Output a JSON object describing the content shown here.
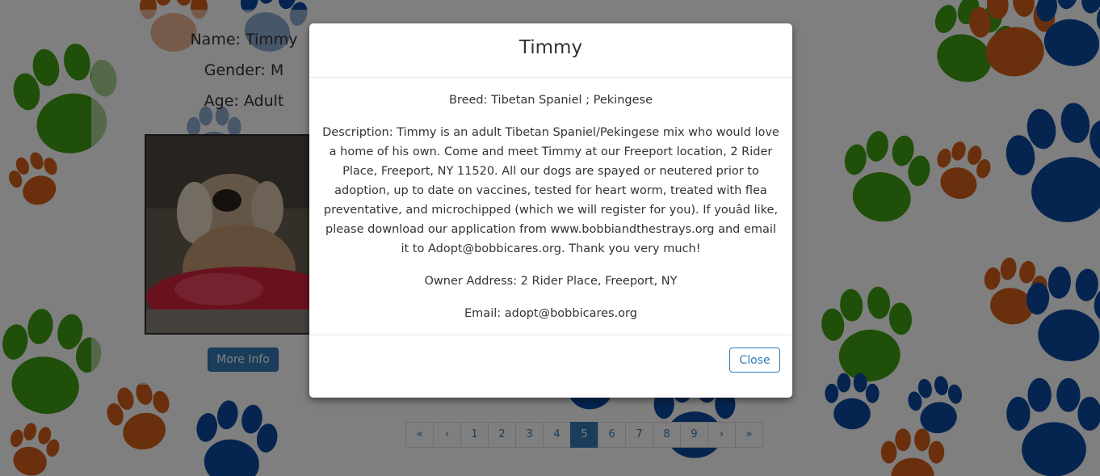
{
  "pet_card": {
    "name": "Name: Timmy",
    "gender": "Gender: M",
    "age": "Age: Adult",
    "more_info_label": "More Info"
  },
  "pagination": {
    "first": "«",
    "prev": "‹",
    "pages": [
      "1",
      "2",
      "3",
      "4",
      "5",
      "6",
      "7",
      "8",
      "9"
    ],
    "active_page": "5",
    "next": "›",
    "last": "»"
  },
  "modal": {
    "title": "Timmy",
    "breed": "Breed: Tibetan Spaniel ; Pekingese",
    "description": "Description: Timmy is an adult Tibetan Spaniel/Pekingese mix who would love a home of his own. Come and meet Timmy at our Freeport location, 2 Rider Place, Freeport, NY 11520. All our dogs are spayed or neutered prior to adoption, up to date on vaccines, tested for heart worm, treated with flea preventative, and microchipped (which we will register for you). If youâd like, please download our application from www.bobbiandthestrays.org and email it to Adopt@bobbicares.org. Thank you very much!",
    "owner_address": "Owner Address: 2 Rider Place, Freeport, NY",
    "email": "Email: adopt@bobbicares.org",
    "close_label": "Close"
  },
  "colors": {
    "paw_green": "#3e9e12",
    "paw_orange": "#d4601a",
    "paw_blue": "#0a4aa0",
    "primary": "#337ab7"
  }
}
